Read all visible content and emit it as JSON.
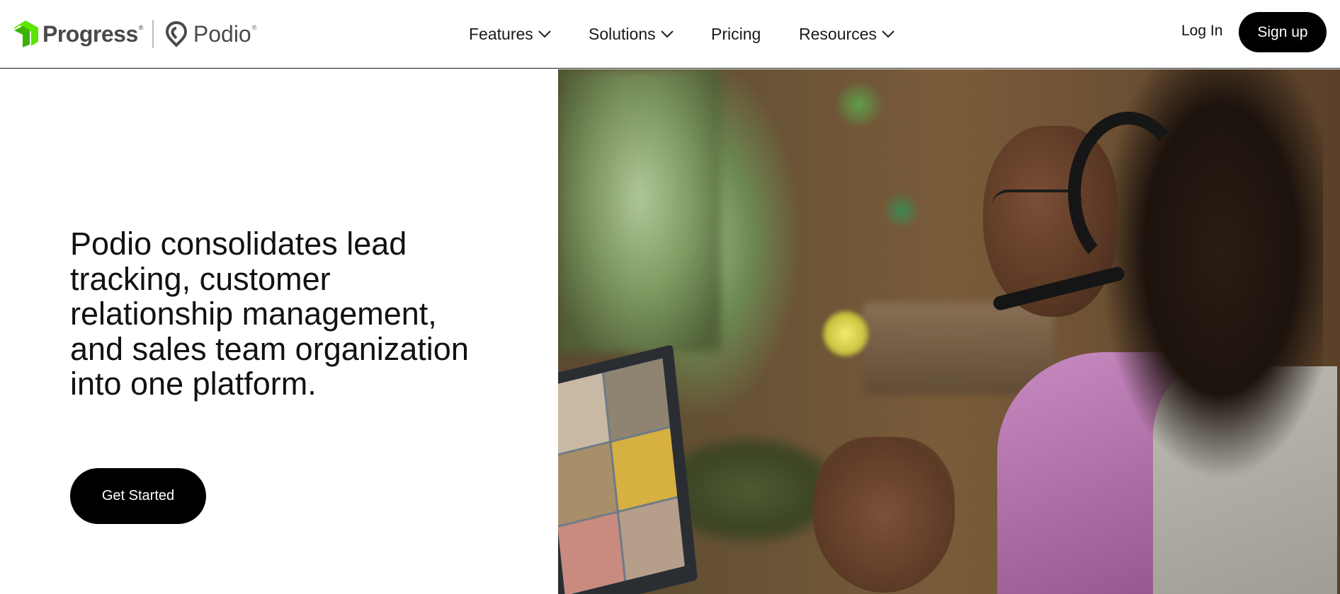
{
  "header": {
    "brand": {
      "progress_name": "Progress",
      "podio_name": "Podio",
      "registered_mark": "®"
    },
    "nav": [
      {
        "label": "Features",
        "has_dropdown": true
      },
      {
        "label": "Solutions",
        "has_dropdown": true
      },
      {
        "label": "Pricing",
        "has_dropdown": false
      },
      {
        "label": "Resources",
        "has_dropdown": true
      }
    ],
    "login_label": "Log In",
    "signup_label": "Sign up"
  },
  "hero": {
    "headline": "Podio consolidates lead tracking, customer relationship management, and sales team organization into one platform.",
    "cta_label": "Get Started"
  },
  "colors": {
    "progress_green": "#5ce500",
    "button_bg": "#000000",
    "text": "#111111"
  },
  "icons": {
    "progress_logo": "progress-logo-icon",
    "podio_logo": "podio-logo-icon",
    "dropdown": "chevron-down-icon"
  }
}
